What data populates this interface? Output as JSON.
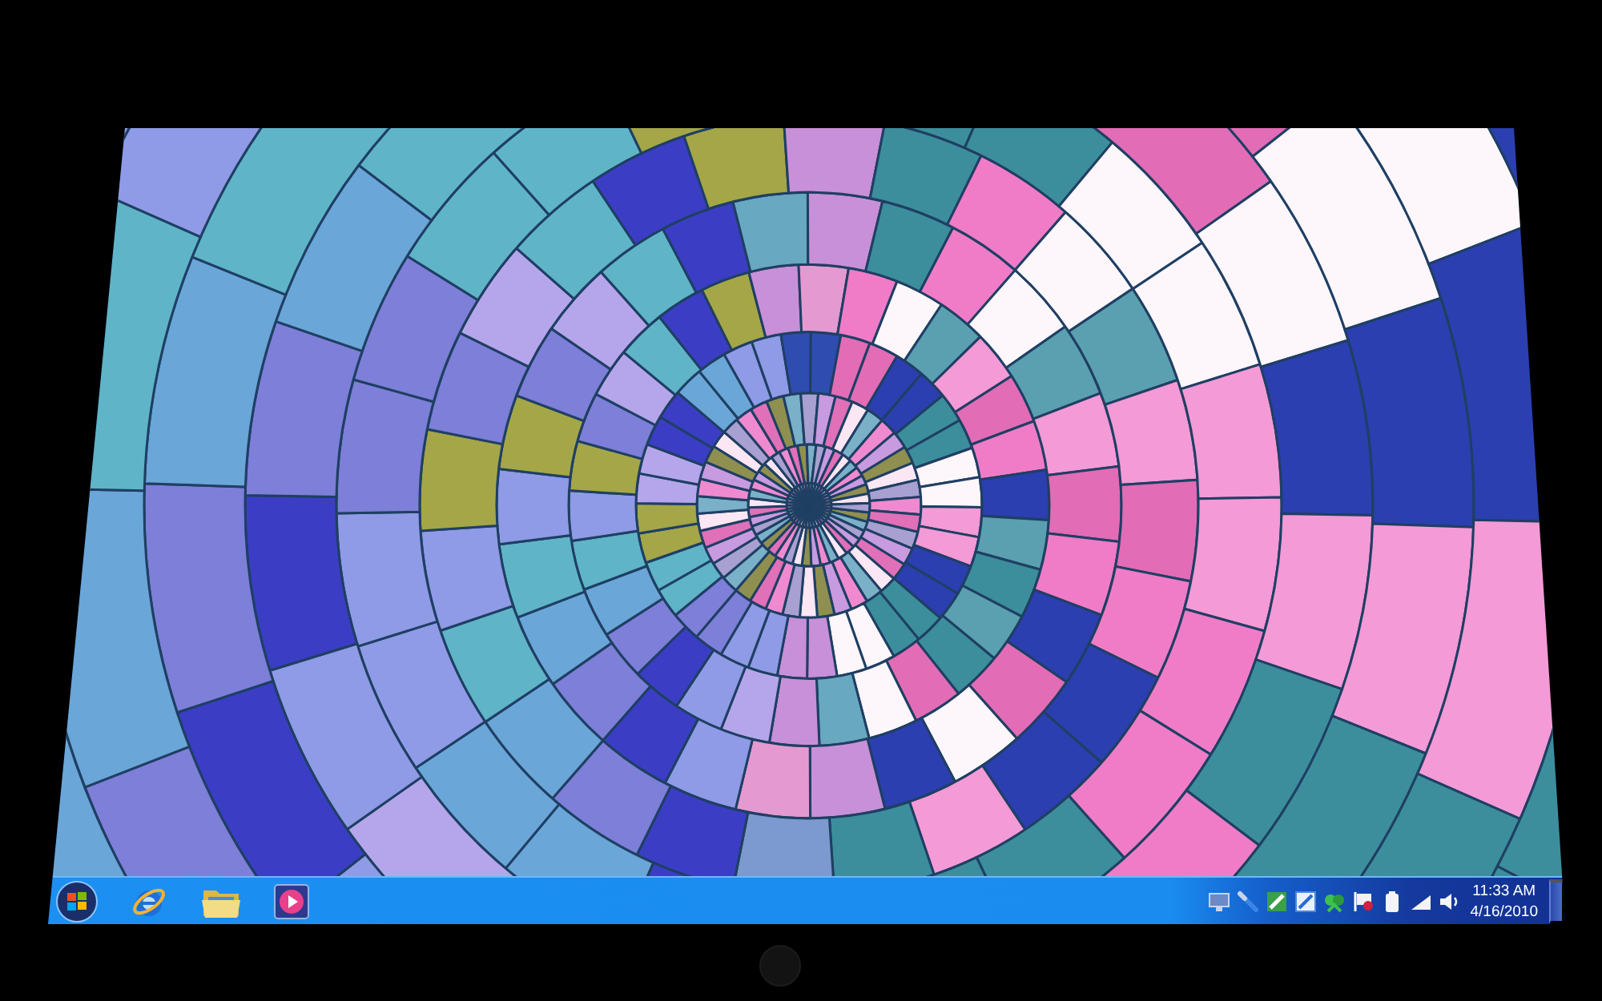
{
  "taskbar": {
    "clock": {
      "time": "11:33 AM",
      "date": "4/16/2010"
    }
  }
}
